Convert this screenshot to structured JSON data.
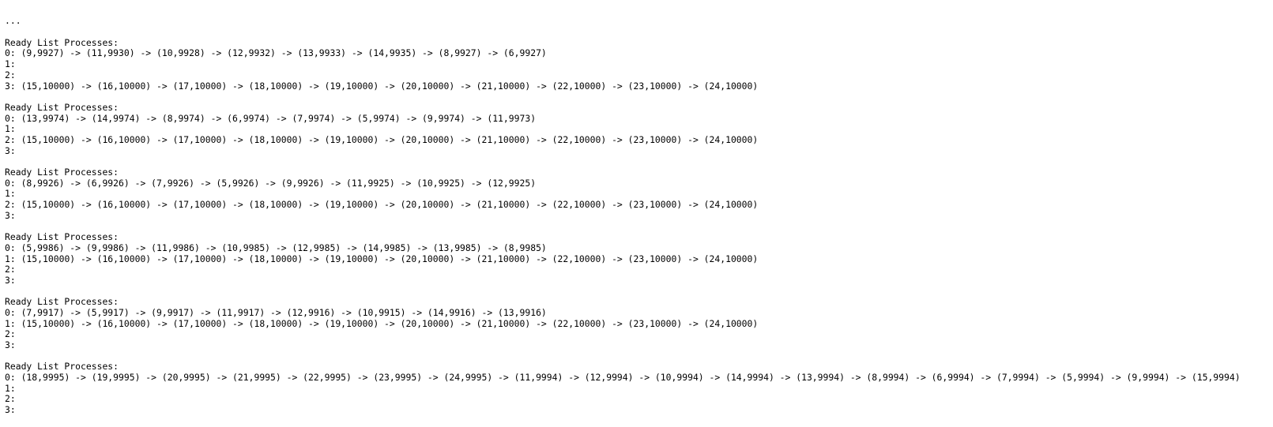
{
  "terminal": {
    "top_cut_line": "...",
    "blocks": [
      {
        "header": "Ready List Processes:",
        "queues": [
          {
            "label": "0:",
            "entries": "(9,9927) -> (11,9930) -> (10,9928) -> (12,9932) -> (13,9933) -> (14,9935) -> (8,9927) -> (6,9927)"
          },
          {
            "label": "1:",
            "entries": ""
          },
          {
            "label": "2:",
            "entries": ""
          },
          {
            "label": "3:",
            "entries": "(15,10000) -> (16,10000) -> (17,10000) -> (18,10000) -> (19,10000) -> (20,10000) -> (21,10000) -> (22,10000) -> (23,10000) -> (24,10000)"
          }
        ]
      },
      {
        "header": "Ready List Processes:",
        "queues": [
          {
            "label": "0:",
            "entries": "(13,9974) -> (14,9974) -> (8,9974) -> (6,9974) -> (7,9974) -> (5,9974) -> (9,9974) -> (11,9973)"
          },
          {
            "label": "1:",
            "entries": ""
          },
          {
            "label": "2:",
            "entries": "(15,10000) -> (16,10000) -> (17,10000) -> (18,10000) -> (19,10000) -> (20,10000) -> (21,10000) -> (22,10000) -> (23,10000) -> (24,10000)"
          },
          {
            "label": "3:",
            "entries": ""
          }
        ]
      },
      {
        "header": "Ready List Processes:",
        "queues": [
          {
            "label": "0:",
            "entries": "(8,9926) -> (6,9926) -> (7,9926) -> (5,9926) -> (9,9926) -> (11,9925) -> (10,9925) -> (12,9925)"
          },
          {
            "label": "1:",
            "entries": ""
          },
          {
            "label": "2:",
            "entries": "(15,10000) -> (16,10000) -> (17,10000) -> (18,10000) -> (19,10000) -> (20,10000) -> (21,10000) -> (22,10000) -> (23,10000) -> (24,10000)"
          },
          {
            "label": "3:",
            "entries": ""
          }
        ]
      },
      {
        "header": "Ready List Processes:",
        "queues": [
          {
            "label": "0:",
            "entries": "(5,9986) -> (9,9986) -> (11,9986) -> (10,9985) -> (12,9985) -> (14,9985) -> (13,9985) -> (8,9985)"
          },
          {
            "label": "1:",
            "entries": "(15,10000) -> (16,10000) -> (17,10000) -> (18,10000) -> (19,10000) -> (20,10000) -> (21,10000) -> (22,10000) -> (23,10000) -> (24,10000)"
          },
          {
            "label": "2:",
            "entries": ""
          },
          {
            "label": "3:",
            "entries": ""
          }
        ]
      },
      {
        "header": "Ready List Processes:",
        "queues": [
          {
            "label": "0:",
            "entries": "(7,9917) -> (5,9917) -> (9,9917) -> (11,9917) -> (12,9916) -> (10,9915) -> (14,9916) -> (13,9916)"
          },
          {
            "label": "1:",
            "entries": "(15,10000) -> (16,10000) -> (17,10000) -> (18,10000) -> (19,10000) -> (20,10000) -> (21,10000) -> (22,10000) -> (23,10000) -> (24,10000)"
          },
          {
            "label": "2:",
            "entries": ""
          },
          {
            "label": "3:",
            "entries": ""
          }
        ]
      },
      {
        "header": "Ready List Processes:",
        "queues": [
          {
            "label": "0:",
            "entries": "(18,9995) -> (19,9995) -> (20,9995) -> (21,9995) -> (22,9995) -> (23,9995) -> (24,9995) -> (11,9994) -> (12,9994) -> (10,9994) -> (14,9994) -> (13,9994) -> (8,9994) -> (6,9994) -> (7,9994) -> (5,9994) -> (9,9994) -> (15,9994)"
          },
          {
            "label": "1:",
            "entries": ""
          },
          {
            "label": "2:",
            "entries": ""
          },
          {
            "label": "3:",
            "entries": ""
          }
        ]
      }
    ]
  }
}
